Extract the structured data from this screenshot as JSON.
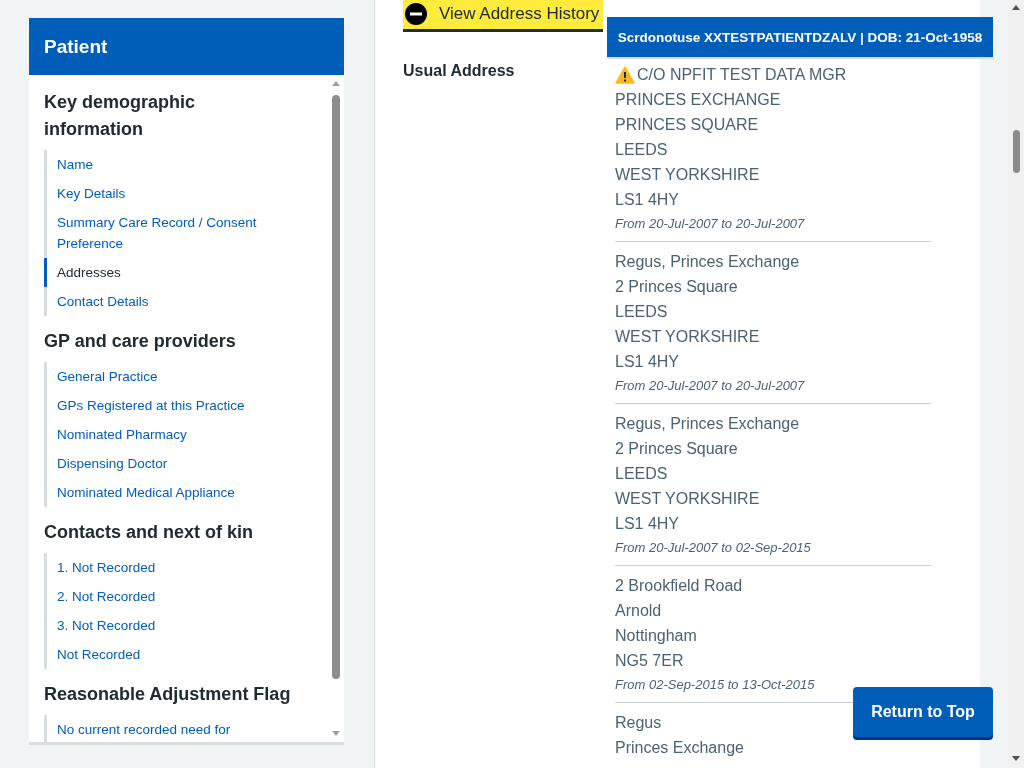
{
  "sidebar": {
    "title": "Patient",
    "sections": [
      {
        "heading": "Key demographic information",
        "items": [
          {
            "label": "Name",
            "selected": false
          },
          {
            "label": "Key Details",
            "selected": false
          },
          {
            "label": "Summary Care Record / Consent Preference",
            "selected": false
          },
          {
            "label": "Addresses",
            "selected": true
          },
          {
            "label": "Contact Details",
            "selected": false
          }
        ]
      },
      {
        "heading": "GP and care providers",
        "items": [
          {
            "label": "General Practice",
            "selected": false
          },
          {
            "label": "GPs Registered at this Practice",
            "selected": false
          },
          {
            "label": "Nominated Pharmacy",
            "selected": false
          },
          {
            "label": "Dispensing Doctor",
            "selected": false
          },
          {
            "label": "Nominated Medical Appliance",
            "selected": false
          }
        ]
      },
      {
        "heading": "Contacts and next of kin",
        "items": [
          {
            "label": "1. Not Recorded",
            "selected": false
          },
          {
            "label": "2. Not Recorded",
            "selected": false
          },
          {
            "label": "3. Not Recorded",
            "selected": false
          },
          {
            "label": "Not Recorded",
            "selected": false
          }
        ]
      },
      {
        "heading": "Reasonable Adjustment Flag",
        "items": [
          {
            "label": "No current recorded need for",
            "selected": false
          }
        ]
      }
    ]
  },
  "history_toggle": {
    "label": "View Address History",
    "expanded": true
  },
  "patient_banner": "Scrdonotuse XXTESTPATIENTDZALV | DOB: 21-Oct-1958",
  "usual_address": {
    "label": "Usual Address",
    "addresses": [
      {
        "flagged": true,
        "lines": [
          "C/O NPFIT TEST DATA MGR",
          "PRINCES EXCHANGE",
          "PRINCES SQUARE",
          "LEEDS",
          "WEST YORKSHIRE",
          "LS1 4HY"
        ],
        "period": "From 20-Jul-2007 to 20-Jul-2007"
      },
      {
        "flagged": false,
        "lines": [
          "Regus, Princes Exchange",
          "2 Princes Square",
          "LEEDS",
          "WEST YORKSHIRE",
          "LS1 4HY"
        ],
        "period": "From 20-Jul-2007 to 20-Jul-2007"
      },
      {
        "flagged": false,
        "lines": [
          "Regus, Princes Exchange",
          "2 Princes Square",
          "LEEDS",
          "WEST YORKSHIRE",
          "LS1 4HY"
        ],
        "period": "From 20-Jul-2007 to 02-Sep-2015"
      },
      {
        "flagged": false,
        "lines": [
          "2 Brookfield Road",
          "Arnold",
          "Nottingham",
          "NG5 7ER"
        ],
        "period": "From 02-Sep-2015 to 13-Oct-2015"
      },
      {
        "flagged": false,
        "lines": [
          "Regus",
          "Princes Exchange"
        ]
      }
    ]
  },
  "return_button": "Return to Top"
}
